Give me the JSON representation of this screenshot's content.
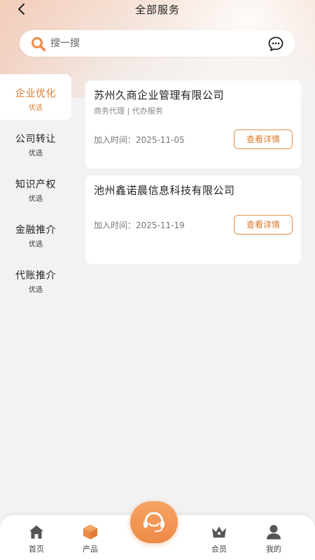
{
  "header": {
    "title": "全部服务"
  },
  "search": {
    "placeholder": "搜一搜"
  },
  "sidebar": {
    "items": [
      {
        "label": "企业优化",
        "sub": "优选",
        "active": true
      },
      {
        "label": "公司转让",
        "sub": "优选"
      },
      {
        "label": "知识产权",
        "sub": "优选"
      },
      {
        "label": "金融推介",
        "sub": "优选"
      },
      {
        "label": "代账推介",
        "sub": "优选"
      }
    ]
  },
  "cards": [
    {
      "title": "苏州久商企业管理有限公司",
      "tags": "商务代理 | 代办服务",
      "date": "加入时间：2025-11-05",
      "button": "查看详情"
    },
    {
      "title": "池州鑫诺晨信息科技有限公司",
      "date": "加入时间：2025-11-19",
      "button": "查看详情"
    }
  ],
  "tabbar": {
    "items": [
      {
        "label": "首页",
        "icon": "home-icon"
      },
      {
        "label": "产品",
        "icon": "box-icon"
      },
      {
        "label": "会员",
        "icon": "crown-icon"
      },
      {
        "label": "我的",
        "icon": "user-icon"
      }
    ],
    "center_icon": "headset-icon"
  },
  "colors": {
    "accent": "#d87a2e",
    "accent_gradient_start": "#f6a464",
    "accent_gradient_end": "#ee8a47"
  }
}
